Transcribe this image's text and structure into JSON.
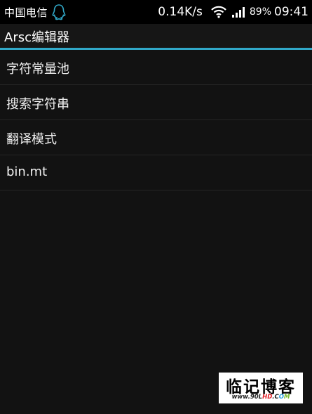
{
  "status_bar": {
    "carrier": "中国电信",
    "network_speed": "0.14K/s",
    "battery": "89%",
    "time": "09:41",
    "icons": [
      "qq-icon",
      "wifi-icon",
      "signal-icon"
    ]
  },
  "action_bar": {
    "title": "Arsc编辑器"
  },
  "menu": {
    "items": [
      {
        "label": "字符常量池"
      },
      {
        "label": "搜索字符串"
      },
      {
        "label": "翻译模式"
      },
      {
        "label": "bin.mt"
      }
    ]
  },
  "watermark": {
    "title": "临记博客",
    "url_part1": "www.90L",
    "url_part2": "HD",
    "url_part3": ".C",
    "url_part4": "O",
    "url_part5": "M"
  },
  "colors": {
    "accent": "#31a9c9",
    "background": "#121212",
    "status_bar": "#000000"
  }
}
